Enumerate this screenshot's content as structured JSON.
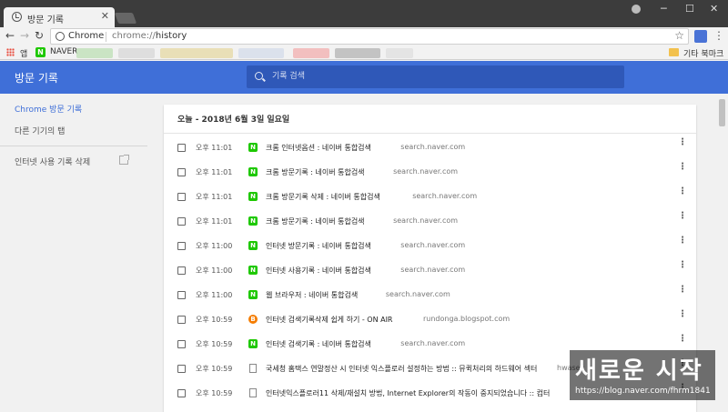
{
  "browser": {
    "tab_title": "방문 기록",
    "tab_close": "✕",
    "window_controls": {
      "minimize": "─",
      "maximize": "☐",
      "close": "✕"
    },
    "nav": {
      "back": "←",
      "forward": "→",
      "reload": "↻"
    },
    "omnibox": {
      "chip": "Chrome",
      "scheme": "chrome://",
      "path": "history",
      "star": "☆"
    },
    "menu": "⋮"
  },
  "bookmarks": {
    "apps_label": "앱",
    "naver_badge": "N",
    "naver_label": "NAVER",
    "other_bookmarks": "기타 북마크"
  },
  "appbar": {
    "title": "방문 기록",
    "search_placeholder": "기록 검색"
  },
  "sidebar": {
    "items": [
      {
        "label": "Chrome 방문 기록"
      },
      {
        "label": "다른 기기의 탭"
      },
      {
        "label": "인터넷 사용 기록 삭제"
      }
    ]
  },
  "history": {
    "date_header": "오늘 - 2018년 6월 3일 일요일",
    "kebab": "⋮",
    "entries": [
      {
        "time": "오후 11:01",
        "favicon": "naver",
        "badge": "N",
        "title": "크롬 인터넷옵션 : 네이버 통합검색",
        "domain": "search.naver.com"
      },
      {
        "time": "오후 11:01",
        "favicon": "naver",
        "badge": "N",
        "title": "크롬 방문기록 : 네이버 통합검색",
        "domain": "search.naver.com"
      },
      {
        "time": "오후 11:01",
        "favicon": "naver",
        "badge": "N",
        "title": "크롬 방문기록 삭제 : 네이버 통합검색",
        "domain": "search.naver.com"
      },
      {
        "time": "오후 11:01",
        "favicon": "naver",
        "badge": "N",
        "title": "크롬 방문기록 : 네이버 통합검색",
        "domain": "search.naver.com"
      },
      {
        "time": "오후 11:00",
        "favicon": "naver",
        "badge": "N",
        "title": "인터넷 방문기록 : 네이버 통합검색",
        "domain": "search.naver.com"
      },
      {
        "time": "오후 11:00",
        "favicon": "naver",
        "badge": "N",
        "title": "인터넷 사용기록 : 네이버 통합검색",
        "domain": "search.naver.com"
      },
      {
        "time": "오후 11:00",
        "favicon": "naver",
        "badge": "N",
        "title": "웹 브라우저 : 네이버 통합검색",
        "domain": "search.naver.com"
      },
      {
        "time": "오후 10:59",
        "favicon": "blogger",
        "badge": "B",
        "title": "인터넷 검색기록삭제 쉽게 하기 - ON AIR",
        "domain": "rundonga.blogspot.com"
      },
      {
        "time": "오후 10:59",
        "favicon": "naver",
        "badge": "N",
        "title": "인터넷 검색기록 : 네이버 통합검색",
        "domain": "search.naver.com"
      },
      {
        "time": "오후 10:59",
        "favicon": "doc",
        "badge": "",
        "title": "국세청 홈택스 연말정산 시 인터넷 익스플로러 설정하는 방법 :: 뮤퀵처리의 하드웨어 섹터",
        "domain": "hwasec"
      },
      {
        "time": "오후 10:59",
        "favicon": "doc",
        "badge": "",
        "title": "인터넷익스플로러11 삭제/재설치 방법, Internet Explorer의 작동이 중지되었습니다 :: 컴터",
        "domain": ""
      }
    ]
  },
  "watermark": {
    "title": "새로운 시작",
    "url": "https://blog.naver.com/fhrm1841"
  }
}
